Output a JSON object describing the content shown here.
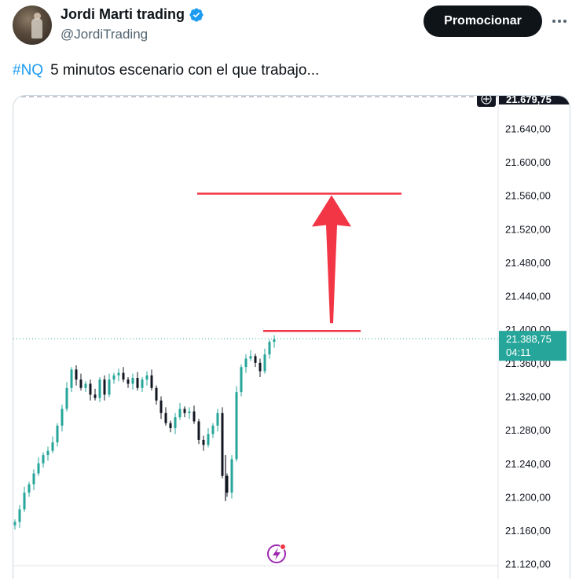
{
  "header": {
    "name": "Jordi Marti trading",
    "handle": "@JordiTrading",
    "promote_label": "Promocionar"
  },
  "tweet": {
    "hashtag": "#NQ",
    "text": "5 minutos escenario con el que trabajo..."
  },
  "chart_data": {
    "type": "candlestick",
    "y_ticks": [
      "21.640,00",
      "21.600,00",
      "21.560,00",
      "21.520,00",
      "21.480,00",
      "21.440,00",
      "21.400,00",
      "21.360,00",
      "21.320,00",
      "21.280,00",
      "21.240,00",
      "21.200,00",
      "21.160,00",
      "21.120,00"
    ],
    "top_label": "21.679,75",
    "last_price": "21.388,75",
    "countdown": "04:11",
    "ylim": [
      21120,
      21680
    ],
    "annotations": {
      "target_level": 21562,
      "breakout_level": 21398,
      "arrow": "up"
    },
    "colors": {
      "up": "#26a69a",
      "down": "#131722",
      "annotation": "#f23645",
      "price_badge": "#26a69a"
    }
  }
}
